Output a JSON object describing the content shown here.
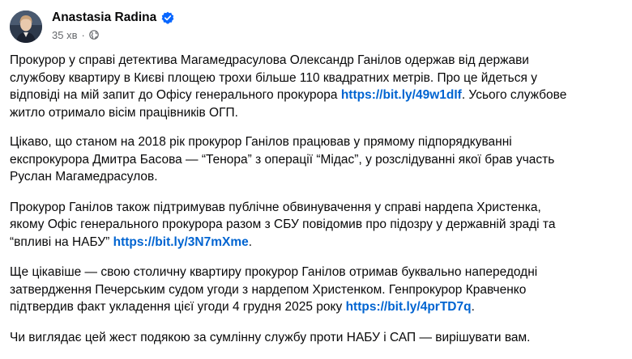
{
  "post": {
    "author": "Anastasia Radina",
    "time": "35 хв",
    "separator": "·",
    "paragraphs": [
      {
        "before": "Прокурор у справі детектива Магамедрасулова Олександр Ганілов одержав від держави\nслужбову квартиру в Києві площею трохи більше 110 квадратних метрів. Про це йдеться у\nвідповіді на мій запит до Офісу генерального прокурора ",
        "link": "https://bit.ly/49w1dIf",
        "after": ". Усього службове\nжитло отримало вісім працівників ОГП."
      },
      {
        "before": "Цікаво, що станом на 2018 рік прокурор Ганілов працював у прямому підпорядкуванні\nекспрокурора Дмитра Басова — “Тенора” з операції “Мідас”, у розслідуванні якої брав участь\nРуслан Магамедрасулов.",
        "link": "",
        "after": ""
      },
      {
        "before": "Прокурор Ганілов також підтримував публічне обвинувачення у справі нардепа Христенка,\nякому Офіс генерального прокурора разом з СБУ повідомив про підозру у державній зраді та\n“впливі на НАБУ” ",
        "link": "https://bit.ly/3N7mXme",
        "after": "."
      },
      {
        "before": "Ще цікавіше — свою столичну квартиру прокурор Ганілов отримав буквально напередодні\nзатвердження Печерським судом угоди з нардепом Христенком. Генпрокурор Кравченко\nпідтвердив факт укладення цієї угоди 4 грудня 2025 року ",
        "link": "https://bit.ly/4prTD7q",
        "after": "."
      },
      {
        "before": "Чи виглядає цей жест подякою за сумлінну службу проти НАБУ і САП — вирішувати вам.",
        "link": "",
        "after": ""
      }
    ]
  },
  "icons": {
    "verified": "verified-badge-icon",
    "audience": "globe-icon"
  },
  "colors": {
    "text": "#080809",
    "secondary_text": "#65686c",
    "link": "#0064d1",
    "verified_badge": "#0866ff"
  }
}
